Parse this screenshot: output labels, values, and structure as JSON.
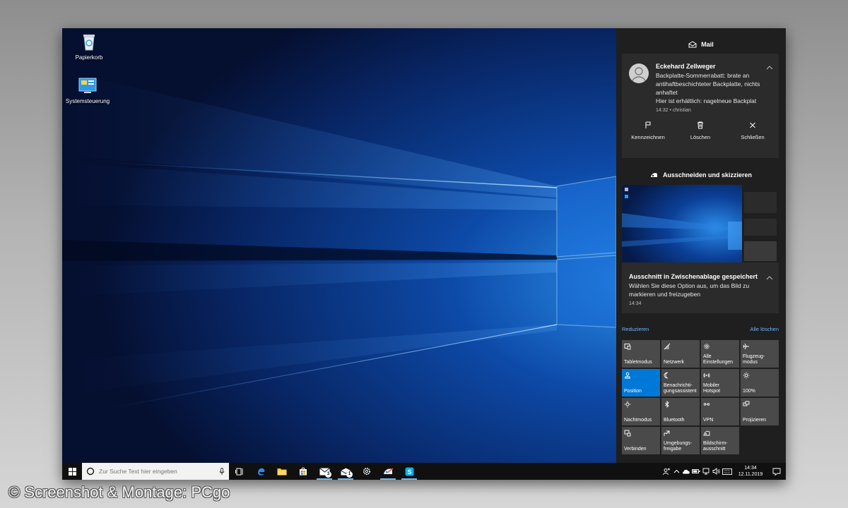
{
  "desktop": {
    "icons": [
      {
        "label": "Papierkorb",
        "icon": "recycle-bin-icon"
      },
      {
        "label": "Systemsteuerung",
        "icon": "control-panel-icon"
      }
    ]
  },
  "action_center": {
    "mail_group": {
      "title": "Mail",
      "notification": {
        "sender": "Eckehard Zellweger",
        "line1": "Backplatte-Sommerrabatt: brate an antihaftbeschichteter Backplatte, nichts anhaftet",
        "line2": "Hier ist erhältlich: nagelneue Backplat",
        "meta": "14:32 • christian",
        "actions": [
          {
            "label": "Kennzeichnen",
            "icon": "flag-icon"
          },
          {
            "label": "Löschen",
            "icon": "trash-icon"
          },
          {
            "label": "Schließen",
            "icon": "close-icon"
          }
        ]
      }
    },
    "snip_group": {
      "title": "Ausschneiden und skizzieren",
      "notification": {
        "title": "Ausschnitt in Zwischenablage gespeichert",
        "text": "Wählen Sie diese Option aus, um das Bild zu markieren und freizugeben",
        "time": "14:34"
      }
    },
    "collapse_label": "Reduzieren",
    "clear_all_label": "Alle löschen",
    "quick_actions": [
      {
        "label": "Tabletmodus",
        "icon": "tablet-mode-icon",
        "active": false
      },
      {
        "label": "Netzwerk",
        "icon": "network-icon",
        "active": false
      },
      {
        "label": "Alle Einstellungen",
        "icon": "settings-icon",
        "active": false
      },
      {
        "label": "Flugzeug-modus",
        "icon": "airplane-icon",
        "active": false
      },
      {
        "label": "Position",
        "icon": "location-icon",
        "active": true
      },
      {
        "label": "Benachrichti-gungsassistent",
        "icon": "moon-icon",
        "active": false
      },
      {
        "label": "Mobiler Hotspot",
        "icon": "hotspot-icon",
        "active": false
      },
      {
        "label": "100%",
        "icon": "brightness-icon",
        "active": false
      },
      {
        "label": "Nachtmodus",
        "icon": "night-light-icon",
        "active": false
      },
      {
        "label": "Bluetooth",
        "icon": "bluetooth-icon",
        "active": false
      },
      {
        "label": "VPN",
        "icon": "vpn-icon",
        "active": false
      },
      {
        "label": "Projizieren",
        "icon": "project-icon",
        "active": false
      },
      {
        "label": "Verbinden",
        "icon": "connect-icon",
        "active": false
      },
      {
        "label": "Umgebungs-freigabe",
        "icon": "nearby-share-icon",
        "active": false
      },
      {
        "label": "Bildschirm-ausschnitt",
        "icon": "screen-snip-icon",
        "active": false
      }
    ]
  },
  "taskbar": {
    "search_placeholder": "Zur Suche Text hier eingeben",
    "apps": [
      {
        "icon": "task-view-icon",
        "badge": ""
      },
      {
        "icon": "edge-icon",
        "badge": ""
      },
      {
        "icon": "file-explorer-icon",
        "badge": ""
      },
      {
        "icon": "store-icon",
        "badge": ""
      },
      {
        "icon": "mail-icon",
        "badge": "3"
      },
      {
        "icon": "mail-app-icon",
        "badge": "1"
      },
      {
        "icon": "settings-icon",
        "badge": ""
      },
      {
        "icon": "snip-sketch-icon",
        "badge": ""
      },
      {
        "icon": "skype-icon",
        "badge": ""
      }
    ],
    "clock_time": "14:34",
    "clock_date": "12.11.2019"
  },
  "watermark": "© Screenshot & Montage: PCgo",
  "colors": {
    "accent": "#0078d7",
    "action_center_bg": "#1f1f1f",
    "card_bg": "#2b2b2b",
    "tile_bg": "#4a4a4a",
    "link": "#6ab7ff"
  }
}
